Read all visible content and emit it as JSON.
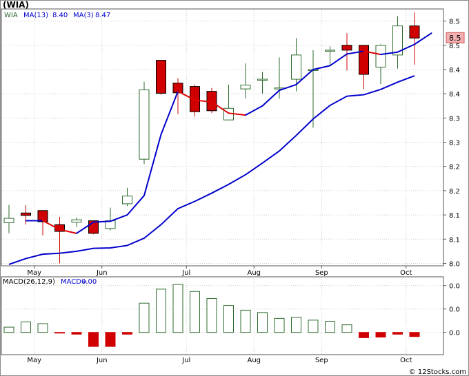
{
  "title": "(WIA)",
  "legend": {
    "symbol": "WIA",
    "ma_slow_label": "MA(13)",
    "ma_slow_value": "8.40",
    "ma_fast_label": "MA(3)",
    "ma_fast_value": "8.47"
  },
  "macd_legend": {
    "label": "MACD(26,12,9)",
    "value_label": "MACD=",
    "value": "0.00"
  },
  "last_price_label": "8.5",
  "watermark": "© 12Stocks.com",
  "colors": {
    "up": "#2d6b2d",
    "down": "#d00000",
    "ma_slow": "#0000cc",
    "ma_fast_down": "#e00000",
    "ma_fast_up": "#0000cc",
    "grid": "#cfcfcf",
    "price_tag_bg": "#f4b0b0"
  },
  "chart_data": [
    {
      "type": "candlestick",
      "title": "(WIA)",
      "x_ticks": [
        "May",
        "Jun",
        "Jul",
        "Aug",
        "Sep",
        "Oct"
      ],
      "x_tick_index": [
        1.5,
        5.5,
        10.5,
        14.5,
        18.5,
        23.5
      ],
      "y_ticks": [
        {
          "value": 8.0,
          "label": "8.0"
        },
        {
          "value": 8.05,
          "label": "8.1"
        },
        {
          "value": 8.1,
          "label": "8.1"
        },
        {
          "value": 8.15,
          "label": "8.2"
        },
        {
          "value": 8.2,
          "label": "8.2"
        },
        {
          "value": 8.25,
          "label": "8.3"
        },
        {
          "value": 8.3,
          "label": "8.3"
        },
        {
          "value": 8.35,
          "label": "8.4"
        },
        {
          "value": 8.4,
          "label": "8.4"
        },
        {
          "value": 8.45,
          "label": "8.5"
        },
        {
          "value": 8.5,
          "label": "8.5"
        }
      ],
      "ylim": [
        7.995,
        8.525
      ],
      "candles": [
        {
          "o": 8.084,
          "h": 8.121,
          "l": 8.062,
          "c": 8.093
        },
        {
          "o": 8.104,
          "h": 8.12,
          "l": 8.08,
          "c": 8.099
        },
        {
          "o": 8.109,
          "h": 8.109,
          "l": 8.058,
          "c": 8.086
        },
        {
          "o": 8.08,
          "h": 8.096,
          "l": 8.0,
          "c": 8.066
        },
        {
          "o": 8.085,
          "h": 8.095,
          "l": 8.075,
          "c": 8.09
        },
        {
          "o": 8.088,
          "h": 8.088,
          "l": 8.06,
          "c": 8.062
        },
        {
          "o": 8.072,
          "h": 8.115,
          "l": 8.068,
          "c": 8.088
        },
        {
          "o": 8.123,
          "h": 8.156,
          "l": 8.118,
          "c": 8.139
        },
        {
          "o": 8.215,
          "h": 8.375,
          "l": 8.205,
          "c": 8.358
        },
        {
          "o": 8.419,
          "h": 8.419,
          "l": 8.348,
          "c": 8.351
        },
        {
          "o": 8.372,
          "h": 8.382,
          "l": 8.308,
          "c": 8.352
        },
        {
          "o": 8.365,
          "h": 8.369,
          "l": 8.303,
          "c": 8.313
        },
        {
          "o": 8.355,
          "h": 8.362,
          "l": 8.31,
          "c": 8.315
        },
        {
          "o": 8.296,
          "h": 8.369,
          "l": 8.296,
          "c": 8.32
        },
        {
          "o": 8.36,
          "h": 8.413,
          "l": 8.34,
          "c": 8.368
        },
        {
          "o": 8.38,
          "h": 8.395,
          "l": 8.35,
          "c": 8.38
        },
        {
          "o": 8.362,
          "h": 8.425,
          "l": 8.34,
          "c": 8.362
        },
        {
          "o": 8.38,
          "h": 8.465,
          "l": 8.355,
          "c": 8.43
        },
        {
          "o": 8.4,
          "h": 8.44,
          "l": 8.28,
          "c": 8.4
        },
        {
          "o": 8.438,
          "h": 8.448,
          "l": 8.41,
          "c": 8.44
        },
        {
          "o": 8.45,
          "h": 8.475,
          "l": 8.398,
          "c": 8.44
        },
        {
          "o": 8.45,
          "h": 8.45,
          "l": 8.36,
          "c": 8.39
        },
        {
          "o": 8.405,
          "h": 8.452,
          "l": 8.37,
          "c": 8.45
        },
        {
          "o": 8.43,
          "h": 8.51,
          "l": 8.402,
          "c": 8.49
        },
        {
          "o": 8.49,
          "h": 8.518,
          "l": 8.41,
          "c": 8.465
        }
      ],
      "ma13": [
        7.998,
        8.01,
        8.019,
        8.021,
        8.025,
        8.031,
        8.032,
        8.037,
        8.052,
        8.08,
        8.113,
        8.128,
        8.145,
        8.163,
        8.183,
        8.207,
        8.232,
        8.264,
        8.298,
        8.326,
        8.345,
        8.348,
        8.359,
        8.374,
        8.387
      ],
      "ma3_start_index": 1,
      "ma3": [
        8.088,
        8.088,
        8.07,
        8.062,
        8.085,
        8.087,
        8.1,
        8.14,
        8.266,
        8.355,
        8.337,
        8.333,
        8.31,
        8.306,
        8.325,
        8.357,
        8.369,
        8.4,
        8.408,
        8.432,
        8.438,
        8.431,
        8.436,
        8.452,
        8.475
      ]
    },
    {
      "type": "bar",
      "title": "MACD(26,12,9)",
      "categories_index": [
        0,
        1,
        2,
        3,
        4,
        5,
        6,
        7,
        8,
        9,
        10,
        11,
        12,
        13,
        14,
        15,
        16,
        17,
        18,
        19,
        20,
        21,
        22,
        23,
        24
      ],
      "values": [
        0.0045,
        0.009,
        0.0075,
        -0.0004,
        -0.0015,
        -0.012,
        -0.012,
        -0.0015,
        0.025,
        0.037,
        0.041,
        0.035,
        0.029,
        0.023,
        0.019,
        0.017,
        0.012,
        0.013,
        0.0105,
        0.0095,
        0.0065,
        -0.0045,
        -0.004,
        -0.0015,
        -0.0035
      ],
      "y_ticks": [
        {
          "value": 0.04,
          "label": "0.0"
        },
        {
          "value": 0.02,
          "label": "0.0"
        },
        {
          "value": 0.0,
          "label": "0.0"
        }
      ],
      "ylim": [
        -0.019,
        0.0475
      ]
    }
  ]
}
